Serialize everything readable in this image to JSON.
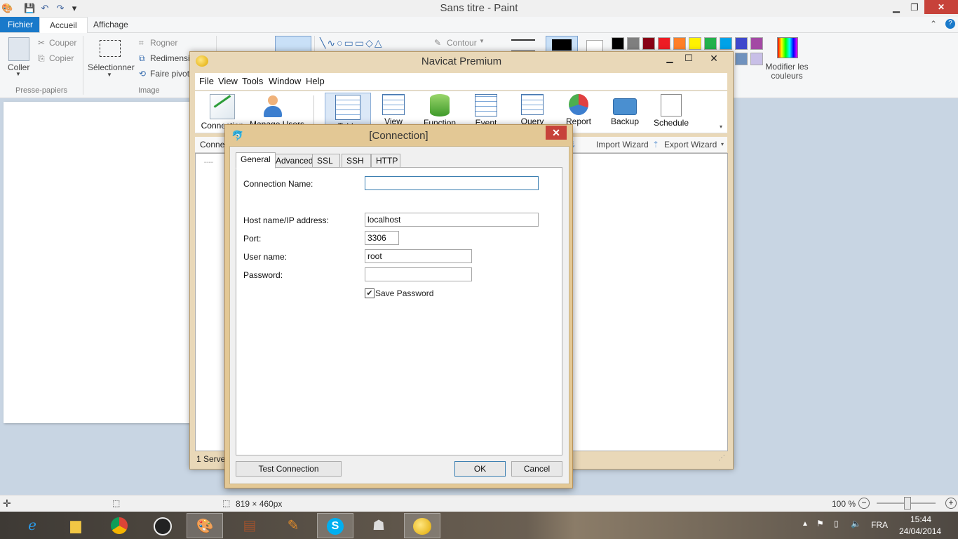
{
  "paint": {
    "title": "Sans titre - Paint",
    "tabs": {
      "file": "Fichier",
      "home": "Accueil",
      "view": "Affichage"
    },
    "ribbon": {
      "paste": "Coller",
      "cut": "Couper",
      "copy": "Copier",
      "clipboard_group": "Presse-papiers",
      "select": "Sélectionner",
      "crop": "Rogner",
      "resize": "Redimensi",
      "rotate": "Faire pivot",
      "image_group": "Image",
      "outline": "Contour",
      "edit_colors": "Modifier les couleurs"
    },
    "colors": [
      "#000000",
      "#7f7f7f",
      "#880015",
      "#ed1c24",
      "#ff7f27",
      "#fff200",
      "#22b14c",
      "#00a2e8",
      "#3f48cc",
      "#a349a4",
      "#ffffff",
      "#c3c3c3",
      "#b97a57",
      "#ffaec9",
      "#ffc90e",
      "#efe4b0",
      "#b5e61d",
      "#99d9ea",
      "#7092be",
      "#c8bfe7"
    ],
    "status": {
      "size": "819 × 460px",
      "zoom": "100 %"
    }
  },
  "navicat": {
    "title": "Navicat Premium",
    "menu": [
      "File",
      "View",
      "Tools",
      "Window",
      "Help"
    ],
    "toolbar": [
      "Connection",
      "Manage Users",
      "Table",
      "View",
      "Function",
      "Event",
      "Query",
      "Report",
      "Backup",
      "Schedule"
    ],
    "subbar": {
      "left": "Connec",
      "import": "Import Wizard",
      "export": "Export Wizard"
    },
    "status": "1 Server"
  },
  "dialog": {
    "title": "[Connection]",
    "tabs": [
      "General",
      "Advanced",
      "SSL",
      "SSH",
      "HTTP"
    ],
    "fields": {
      "connection_name_label": "Connection Name:",
      "connection_name_value": "",
      "host_label": "Host name/IP address:",
      "host_value": "localhost",
      "port_label": "Port:",
      "port_value": "3306",
      "user_label": "User name:",
      "user_value": "root",
      "password_label": "Password:",
      "password_value": "",
      "save_password_label": "Save Password",
      "save_password_checked": true
    },
    "buttons": {
      "test": "Test Connection",
      "ok": "OK",
      "cancel": "Cancel"
    }
  },
  "taskbar": {
    "language": "FRA",
    "time": "15:44",
    "date": "24/04/2014"
  }
}
